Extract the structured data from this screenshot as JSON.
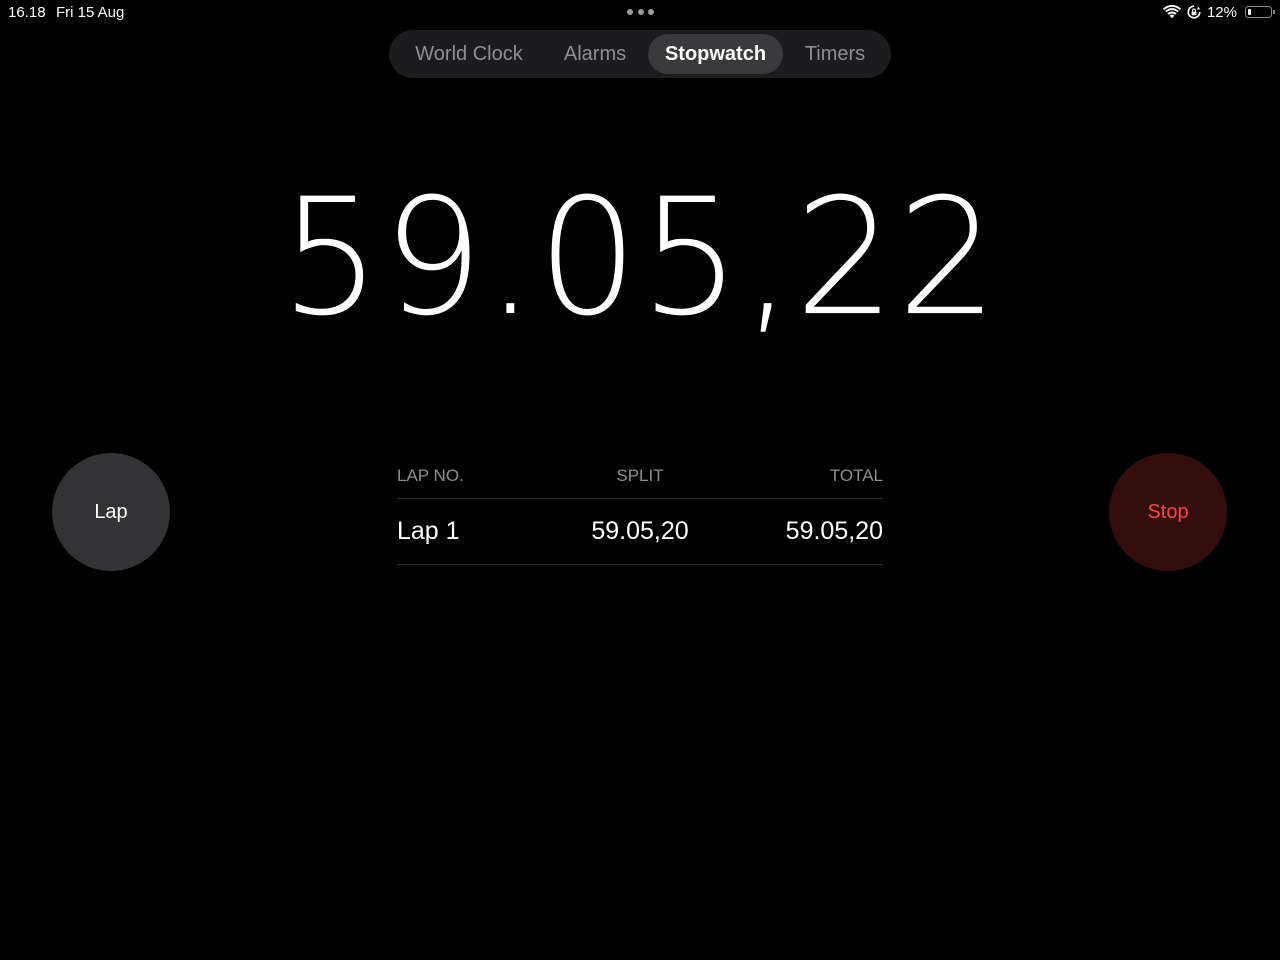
{
  "status_bar": {
    "time": "16.18",
    "date": "Fri 15 Aug",
    "battery_percent": "12%",
    "battery_level": 0.12,
    "icons": [
      "wifi-icon",
      "orientation-lock-icon",
      "battery-icon"
    ]
  },
  "tabs": [
    {
      "label": "World Clock",
      "active": false
    },
    {
      "label": "Alarms",
      "active": false
    },
    {
      "label": "Stopwatch",
      "active": true
    },
    {
      "label": "Timers",
      "active": false
    }
  ],
  "stopwatch": {
    "elapsed": "59.05,22"
  },
  "buttons": {
    "lap_label": "Lap",
    "stop_label": "Stop"
  },
  "laps": {
    "headers": {
      "lap_no": "LAP NO.",
      "split": "SPLIT",
      "total": "TOTAL"
    },
    "rows": [
      {
        "lap": "Lap 1",
        "split": "59.05,20",
        "total": "59.05,20"
      }
    ]
  },
  "colors": {
    "background": "#000000",
    "stop_text": "#ff453a",
    "stop_bg": "#330e0c",
    "lap_bg": "#333336",
    "secondary_text": "#8e8e93"
  }
}
